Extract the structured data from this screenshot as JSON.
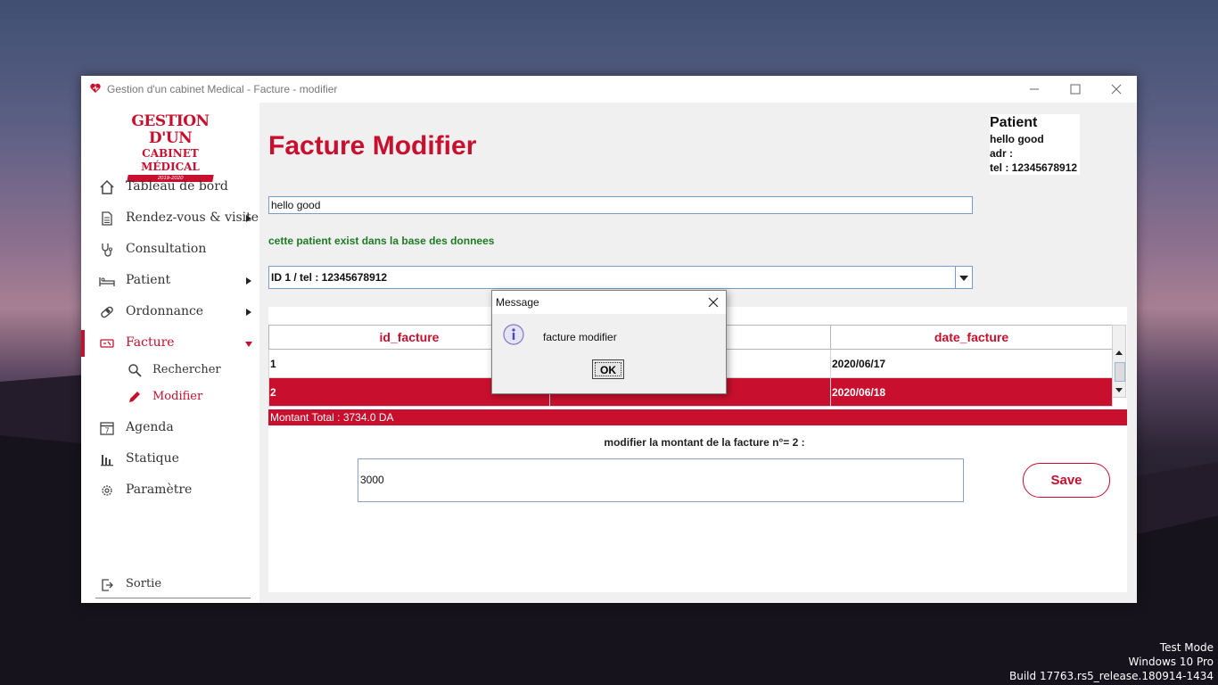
{
  "window": {
    "title": "Gestion d'un cabinet Medical - Facture - modifier"
  },
  "logo": {
    "line1": "GESTION D'UN",
    "line2": "CABINET MÉDICAL",
    "line3": "2019-2020"
  },
  "sidebar": {
    "items": [
      {
        "label": "Tableau de bord",
        "icon": "home-icon"
      },
      {
        "label": "Rendez-vous & visite",
        "icon": "document-icon"
      },
      {
        "label": "Consultation",
        "icon": "stethoscope-icon"
      },
      {
        "label": "Patient",
        "icon": "bed-icon"
      },
      {
        "label": "Ordonnance",
        "icon": "pill-icon"
      },
      {
        "label": "Facture",
        "icon": "invoice-icon"
      },
      {
        "label": "Agenda",
        "icon": "calendar-icon"
      },
      {
        "label": "Statique",
        "icon": "bar-chart-icon"
      },
      {
        "label": "Paramètre",
        "icon": "gear-icon"
      }
    ],
    "subitems": [
      {
        "label": "Rechercher",
        "icon": "search-icon"
      },
      {
        "label": "Modifier",
        "icon": "pencil-icon"
      }
    ],
    "exit_label": "Sortie",
    "calendar_day": "7"
  },
  "main": {
    "title": "Facture Modifier",
    "patient_card": {
      "heading": "Patient",
      "name": "hello good",
      "address": "adr :",
      "phone": "tel : 12345678912"
    },
    "search_value": "hello good",
    "status_message": "cette patient exist dans la base des donnees",
    "combo_value": "ID 1 / tel : 12345678912",
    "table": {
      "headers": [
        "id_facture",
        "",
        "date_facture"
      ],
      "rows": [
        {
          "id": "1",
          "mid": "",
          "date": "2020/06/17"
        },
        {
          "id": "2",
          "mid": "",
          "date": "2020/06/18"
        }
      ]
    },
    "total_label": "Montant Total : 3734.0 DA",
    "modify_label": "modifier la montant de la facture n°= 2 :",
    "amount_value": "3000",
    "save_label": "Save"
  },
  "dialog": {
    "title": "Message",
    "message": "facture modifier",
    "ok_label": "OK"
  },
  "watermark": {
    "line1": "Test Mode",
    "line2": "Windows 10 Pro",
    "line3": "Build 17763.rs5_release.180914-1434"
  },
  "colors": {
    "accent": "#c8102e",
    "success": "#1d7b23"
  }
}
